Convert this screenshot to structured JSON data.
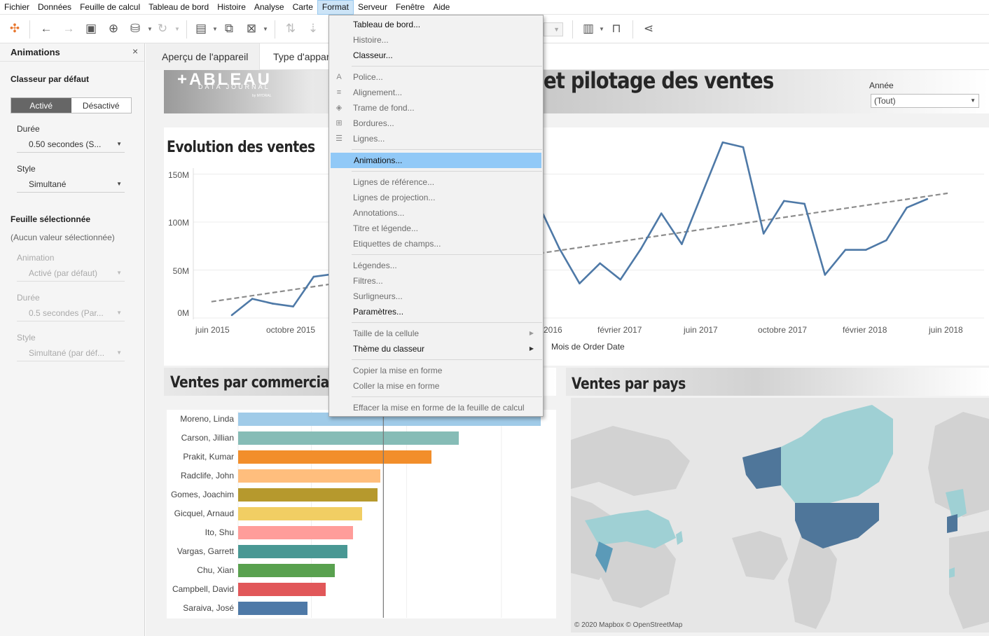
{
  "menubar": [
    "Fichier",
    "Données",
    "Feuille de calcul",
    "Tableau de bord",
    "Histoire",
    "Analyse",
    "Carte",
    "Format",
    "Serveur",
    "Fenêtre",
    "Aide"
  ],
  "toolbar": {
    "icons": [
      "tableau-logo-icon",
      "undo-icon",
      "redo-icon",
      "save-icon",
      "new-datasource-icon",
      "datasource-icon",
      "refresh-icon",
      "new-worksheet-icon",
      "duplicate-sheet-icon",
      "clear-sheet-icon",
      "swap-icon",
      "sort-icon",
      "show-me-icon",
      "presentation-icon",
      "share-icon"
    ]
  },
  "left_panel": {
    "title": "Animations",
    "close": "×",
    "default_section": "Classeur par défaut",
    "toggle_on": "Activé",
    "toggle_off": "Désactivé",
    "duration_label": "Durée",
    "duration_value": "0.50 secondes (S...",
    "style_label": "Style",
    "style_value": "Simultané",
    "selected_section": "Feuille sélectionnée",
    "selected_note": "(Aucun valeur sélectionnée)",
    "sel_animation_label": "Animation",
    "sel_animation_value": "Activé (par défaut)",
    "sel_duration_label": "Durée",
    "sel_duration_value": "0.5 secondes (Par...",
    "sel_style_label": "Style",
    "sel_style_value": "Simultané (par déf..."
  },
  "device_bar": {
    "tab1": "Aperçu de l'appareil",
    "tab2": "Type d'appar"
  },
  "dashboard": {
    "logo_main": "+ABLEAU",
    "logo_sub": "DATA JOURNAL",
    "logo_mark": "by MYDRAL",
    "title": "et pilotage des ventes",
    "filter_label": "Année",
    "filter_value": "(Tout)",
    "line_title": "Evolution des ventes",
    "line_xlabel": "Mois de Order Date",
    "bar_title": "Ventes par commercial",
    "map_title": "Ventes par pays",
    "map_credit": "© 2020 Mapbox © OpenStreetMap"
  },
  "format_menu": {
    "items": [
      {
        "label": "Tableau de bord...",
        "enabled": true
      },
      {
        "label": "Histoire...",
        "enabled": false
      },
      {
        "label": "Classeur...",
        "enabled": true
      },
      {
        "label": "Police...",
        "enabled": false,
        "icon": "A"
      },
      {
        "label": "Alignement...",
        "enabled": false,
        "icon": "≡"
      },
      {
        "label": "Trame de fond...",
        "enabled": false,
        "icon": "◈"
      },
      {
        "label": "Bordures...",
        "enabled": false,
        "icon": "⊞"
      },
      {
        "label": "Lignes...",
        "enabled": false,
        "icon": "☰"
      },
      {
        "label": "Animations...",
        "enabled": true,
        "highlighted": true
      },
      {
        "label": "Lignes de référence...",
        "enabled": false
      },
      {
        "label": "Lignes de projection...",
        "enabled": false
      },
      {
        "label": "Annotations...",
        "enabled": false
      },
      {
        "label": "Titre et légende...",
        "enabled": false
      },
      {
        "label": "Etiquettes de champs...",
        "enabled": false
      },
      {
        "label": "Légendes...",
        "enabled": false
      },
      {
        "label": "Filtres...",
        "enabled": false
      },
      {
        "label": "Surligneurs...",
        "enabled": false
      },
      {
        "label": "Paramètres...",
        "enabled": true
      },
      {
        "label": "Taille de la cellule",
        "enabled": false,
        "submenu": true
      },
      {
        "label": "Thème du classeur",
        "enabled": true,
        "submenu": true
      },
      {
        "label": "Copier la mise en forme",
        "enabled": false
      },
      {
        "label": "Coller la mise en forme",
        "enabled": false
      },
      {
        "label": "Effacer la mise en forme de la feuille de calcul",
        "enabled": false
      }
    ]
  },
  "colors": {
    "line": "#4e79a7",
    "trend": "#8c8c8c",
    "menu_highlight": "#91c9f7",
    "toggle_on": "#666666"
  },
  "chart_data": [
    {
      "type": "line",
      "title": "Evolution des ventes",
      "xlabel": "Mois de Order Date",
      "ylabel": "",
      "yticks": [
        "0M",
        "50M",
        "100M",
        "150M"
      ],
      "xticks": [
        "juin 2015",
        "octobre 2015",
        "2016",
        "février 2017",
        "juin 2017",
        "octobre 2017",
        "février 2018",
        "juin 2018"
      ],
      "ylim": [
        0,
        160
      ],
      "series": [
        {
          "values": [
            {
              "x": "2015-06",
              "y": 3
            },
            {
              "x": "2015-07",
              "y": 20
            },
            {
              "x": "2015-08",
              "y": 15
            },
            {
              "x": "2015-09",
              "y": 12
            },
            {
              "x": "2015-10",
              "y": 43
            },
            {
              "x": "2016-08",
              "y": 72
            },
            {
              "x": "2016-09",
              "y": 118
            },
            {
              "x": "2016-10",
              "y": 73
            },
            {
              "x": "2016-11",
              "y": 36
            },
            {
              "x": "2016-12",
              "y": 57
            },
            {
              "x": "2017-01",
              "y": 40
            },
            {
              "x": "2017-02",
              "y": 72
            },
            {
              "x": "2017-03",
              "y": 109
            },
            {
              "x": "2017-04",
              "y": 77
            },
            {
              "x": "2017-05",
              "y": 130
            },
            {
              "x": "2017-06",
              "y": 183
            },
            {
              "x": "2017-07",
              "y": 178
            },
            {
              "x": "2017-08",
              "y": 88
            },
            {
              "x": "2017-09",
              "y": 122
            },
            {
              "x": "2017-10",
              "y": 119
            },
            {
              "x": "2017-11",
              "y": 45
            },
            {
              "x": "2017-12",
              "y": 71
            },
            {
              "x": "2018-01",
              "y": 71
            },
            {
              "x": "2018-02",
              "y": 81
            },
            {
              "x": "2018-03",
              "y": 115
            },
            {
              "x": "2018-04",
              "y": 124
            }
          ]
        }
      ],
      "trend_line": {
        "from": {
          "x": "2015-05",
          "y": 17
        },
        "to": {
          "x": "2018-05",
          "y": 130
        }
      }
    },
    {
      "type": "bar",
      "title": "Ventes par commercial",
      "categories": [
        "Moreno, Linda",
        "Carson, Jillian",
        "Prakit, Kumar",
        "Radclife, John",
        "Gomes, Joachim",
        "Gicquel, Arnaud",
        "Ito, Shu",
        "Vargas, Garrett",
        "Chu, Xian",
        "Campbell, David",
        "Saraiva, José"
      ],
      "values": [
        100,
        73,
        64,
        47,
        46,
        41,
        38,
        36,
        32,
        29,
        23
      ],
      "colors": [
        "#a0cbe8",
        "#86bcb6",
        "#f28e2b",
        "#ffbe7d",
        "#b6992d",
        "#f1ce63",
        "#ff9d9a",
        "#499894",
        "#59a14f",
        "#e15759",
        "#4e79a7"
      ],
      "reference_line": 48
    }
  ]
}
